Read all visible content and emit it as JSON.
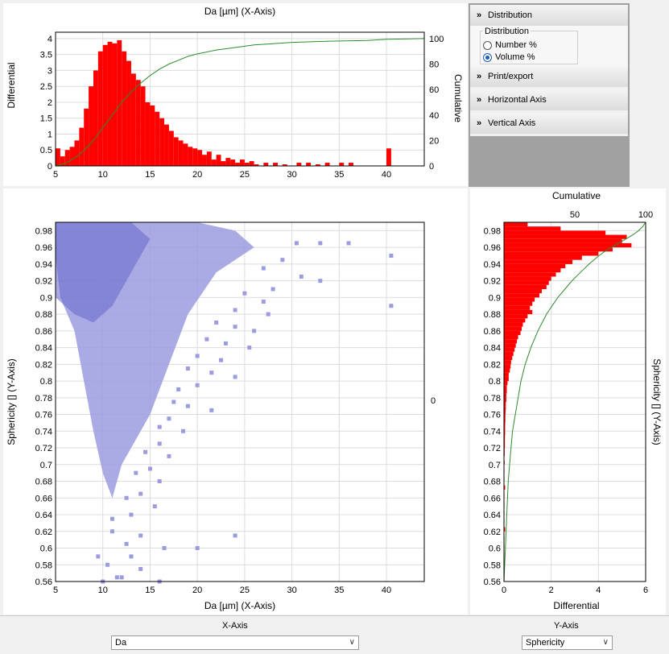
{
  "colors": {
    "histogram": "#ff0000",
    "cumulative": "#2e8b2e",
    "scatter": "#9b9be0",
    "scatter_dense": "#6666cc"
  },
  "panel": {
    "distribution_header": "Distribution",
    "distribution_group": "Distribution",
    "radio_number": "Number %",
    "radio_volume": "Volume %",
    "selected": "Volume %",
    "print_export": "Print/export",
    "horizontal_axis": "Horizontal Axis",
    "vertical_axis": "Vertical Axis",
    "header_icon": "double-chevron-down-icon",
    "item_icon": "double-chevron-right-icon"
  },
  "bottom": {
    "x_axis_label": "X-Axis",
    "x_axis_value": "Da",
    "y_axis_label": "Y-Axis",
    "y_axis_value": "Sphericity"
  },
  "chart_data": [
    {
      "id": "top-histogram",
      "type": "bar",
      "title": "Da [µm] (X-Axis)",
      "ylabel": "Differential",
      "y2label": "Cumulative",
      "xlim": [
        5,
        44
      ],
      "ylim": [
        0,
        4.2
      ],
      "y2lim": [
        0,
        105
      ],
      "xticks": [
        5,
        10,
        15,
        20,
        25,
        30,
        35,
        40
      ],
      "yticks": [
        0,
        0.5,
        1,
        1.5,
        2,
        2.5,
        3,
        3.5,
        4
      ],
      "y2ticks": [
        0,
        20,
        40,
        60,
        80,
        100
      ],
      "grid": true,
      "bin_width": 0.5,
      "bins": [
        [
          5,
          0.55
        ],
        [
          5.5,
          0.3
        ],
        [
          6,
          0.5
        ],
        [
          6.5,
          0.6
        ],
        [
          7,
          0.8
        ],
        [
          7.5,
          1.2
        ],
        [
          8,
          1.8
        ],
        [
          8.5,
          2.5
        ],
        [
          9,
          3.0
        ],
        [
          9.5,
          3.6
        ],
        [
          10,
          3.8
        ],
        [
          10.5,
          3.9
        ],
        [
          11,
          3.85
        ],
        [
          11.5,
          3.95
        ],
        [
          12,
          3.6
        ],
        [
          12.5,
          3.3
        ],
        [
          13,
          2.9
        ],
        [
          13.5,
          2.7
        ],
        [
          14,
          2.5
        ],
        [
          14.5,
          2.0
        ],
        [
          15,
          1.9
        ],
        [
          15.5,
          1.7
        ],
        [
          16,
          1.5
        ],
        [
          16.5,
          1.3
        ],
        [
          17,
          1.1
        ],
        [
          17.5,
          0.9
        ],
        [
          18,
          0.8
        ],
        [
          18.5,
          0.7
        ],
        [
          19,
          0.6
        ],
        [
          19.5,
          0.55
        ],
        [
          20,
          0.5
        ],
        [
          20.5,
          0.35
        ],
        [
          21,
          0.45
        ],
        [
          21.5,
          0.2
        ],
        [
          22,
          0.35
        ],
        [
          22.5,
          0.15
        ],
        [
          23,
          0.25
        ],
        [
          23.5,
          0.2
        ],
        [
          24,
          0.1
        ],
        [
          24.5,
          0.2
        ],
        [
          25,
          0.1
        ],
        [
          25.5,
          0.15
        ],
        [
          26,
          0.05
        ],
        [
          27,
          0.1
        ],
        [
          28,
          0.1
        ],
        [
          29,
          0.05
        ],
        [
          30.5,
          0.1
        ],
        [
          31.5,
          0.1
        ],
        [
          32.5,
          0.05
        ],
        [
          33.5,
          0.1
        ],
        [
          35,
          0.1
        ],
        [
          36,
          0.1
        ],
        [
          40,
          0.55
        ]
      ],
      "cumulative": [
        [
          5,
          0
        ],
        [
          6,
          2
        ],
        [
          7,
          6
        ],
        [
          8,
          12
        ],
        [
          9,
          20
        ],
        [
          10,
          30
        ],
        [
          11,
          40
        ],
        [
          12,
          50
        ],
        [
          13,
          58
        ],
        [
          14,
          65
        ],
        [
          15,
          71
        ],
        [
          16,
          76
        ],
        [
          17,
          80
        ],
        [
          18,
          83
        ],
        [
          19,
          86
        ],
        [
          20,
          88
        ],
        [
          22,
          91
        ],
        [
          24,
          93
        ],
        [
          26,
          95
        ],
        [
          28,
          96
        ],
        [
          30,
          97
        ],
        [
          34,
          98
        ],
        [
          38,
          98.5
        ],
        [
          40,
          99.5
        ],
        [
          44,
          100
        ]
      ]
    },
    {
      "id": "scatter",
      "type": "scatter",
      "xlabel": "Da [µm] (X-Axis)",
      "ylabel": "Sphericity [] (Y-Axis)",
      "xlim": [
        5,
        44
      ],
      "ylim": [
        0.56,
        0.99
      ],
      "xticks": [
        5,
        10,
        15,
        20,
        25,
        30,
        35,
        40
      ],
      "yticks": [
        0.56,
        0.58,
        0.6,
        0.62,
        0.64,
        0.66,
        0.68,
        0.7,
        0.72,
        0.74,
        0.76,
        0.78,
        0.8,
        0.82,
        0.84,
        0.86,
        0.88,
        0.9,
        0.92,
        0.94,
        0.96,
        0.98
      ],
      "y2ticks": [
        0
      ],
      "grid": true,
      "points": [
        [
          30.5,
          0.965
        ],
        [
          33,
          0.965
        ],
        [
          36,
          0.965
        ],
        [
          40.5,
          0.95
        ],
        [
          29,
          0.945
        ],
        [
          27,
          0.935
        ],
        [
          31,
          0.925
        ],
        [
          33,
          0.92
        ],
        [
          28,
          0.91
        ],
        [
          25,
          0.905
        ],
        [
          27,
          0.895
        ],
        [
          40.5,
          0.89
        ],
        [
          24,
          0.885
        ],
        [
          27.5,
          0.88
        ],
        [
          22,
          0.87
        ],
        [
          24,
          0.865
        ],
        [
          26,
          0.86
        ],
        [
          21,
          0.85
        ],
        [
          23,
          0.845
        ],
        [
          25.5,
          0.84
        ],
        [
          20,
          0.83
        ],
        [
          22.5,
          0.825
        ],
        [
          19,
          0.815
        ],
        [
          21.5,
          0.81
        ],
        [
          24,
          0.805
        ],
        [
          20,
          0.795
        ],
        [
          18,
          0.79
        ],
        [
          17.5,
          0.775
        ],
        [
          19,
          0.77
        ],
        [
          21.5,
          0.765
        ],
        [
          17,
          0.755
        ],
        [
          16,
          0.745
        ],
        [
          18.5,
          0.74
        ],
        [
          16,
          0.725
        ],
        [
          14.5,
          0.715
        ],
        [
          17,
          0.71
        ],
        [
          15,
          0.695
        ],
        [
          13.5,
          0.69
        ],
        [
          16,
          0.68
        ],
        [
          14,
          0.665
        ],
        [
          12.5,
          0.66
        ],
        [
          15.5,
          0.65
        ],
        [
          13,
          0.64
        ],
        [
          11,
          0.635
        ],
        [
          24,
          0.615
        ],
        [
          14,
          0.615
        ],
        [
          11,
          0.62
        ],
        [
          12.5,
          0.605
        ],
        [
          16.5,
          0.6
        ],
        [
          20,
          0.6
        ],
        [
          13,
          0.59
        ],
        [
          10.5,
          0.58
        ],
        [
          14,
          0.575
        ],
        [
          9.5,
          0.59
        ],
        [
          11.5,
          0.565
        ],
        [
          10,
          0.56
        ],
        [
          16,
          0.56
        ],
        [
          12,
          0.565
        ]
      ]
    },
    {
      "id": "right-histogram",
      "type": "bar",
      "orientation": "horizontal",
      "xlabel": "Differential",
      "x2label": "Cumulative",
      "ylabel": "Sphericity [] (Y-Axis)",
      "xlim": [
        0,
        6
      ],
      "x2lim": [
        0,
        100
      ],
      "ylim": [
        0.56,
        0.99
      ],
      "xticks": [
        0,
        2,
        4,
        6
      ],
      "x2ticks": [
        50,
        100
      ],
      "yticks": [
        0.56,
        0.58,
        0.6,
        0.62,
        0.64,
        0.66,
        0.68,
        0.7,
        0.72,
        0.74,
        0.76,
        0.78,
        0.8,
        0.82,
        0.84,
        0.86,
        0.88,
        0.9,
        0.92,
        0.94,
        0.96,
        0.98
      ],
      "grid": true,
      "bin_height": 0.005,
      "bins": [
        [
          0.985,
          1.0
        ],
        [
          0.98,
          2.4
        ],
        [
          0.975,
          4.3
        ],
        [
          0.97,
          5.2
        ],
        [
          0.965,
          5.0
        ],
        [
          0.96,
          5.4
        ],
        [
          0.955,
          4.6
        ],
        [
          0.95,
          4.0
        ],
        [
          0.945,
          3.3
        ],
        [
          0.94,
          2.9
        ],
        [
          0.935,
          2.6
        ],
        [
          0.93,
          2.4
        ],
        [
          0.925,
          2.2
        ],
        [
          0.92,
          2.0
        ],
        [
          0.915,
          1.9
        ],
        [
          0.91,
          1.8
        ],
        [
          0.905,
          1.6
        ],
        [
          0.9,
          1.5
        ],
        [
          0.895,
          1.3
        ],
        [
          0.89,
          1.2
        ],
        [
          0.885,
          1.1
        ],
        [
          0.88,
          1.2
        ],
        [
          0.875,
          1.0
        ],
        [
          0.87,
          0.9
        ],
        [
          0.865,
          0.8
        ],
        [
          0.86,
          0.75
        ],
        [
          0.855,
          0.7
        ],
        [
          0.85,
          0.6
        ],
        [
          0.845,
          0.55
        ],
        [
          0.84,
          0.5
        ],
        [
          0.835,
          0.45
        ],
        [
          0.83,
          0.4
        ],
        [
          0.825,
          0.35
        ],
        [
          0.82,
          0.3
        ],
        [
          0.815,
          0.28
        ],
        [
          0.81,
          0.25
        ],
        [
          0.805,
          0.2
        ],
        [
          0.8,
          0.2
        ],
        [
          0.795,
          0.15
        ],
        [
          0.79,
          0.12
        ],
        [
          0.785,
          0.12
        ],
        [
          0.78,
          0.1
        ],
        [
          0.775,
          0.1
        ],
        [
          0.77,
          0.08
        ],
        [
          0.765,
          0.08
        ],
        [
          0.76,
          0.07
        ],
        [
          0.755,
          0.06
        ],
        [
          0.75,
          0.06
        ],
        [
          0.745,
          0.05
        ],
        [
          0.74,
          0.05
        ],
        [
          0.735,
          0.05
        ],
        [
          0.73,
          0.04
        ],
        [
          0.725,
          0.04
        ],
        [
          0.72,
          0.04
        ],
        [
          0.715,
          0.03
        ],
        [
          0.71,
          0.03
        ],
        [
          0.7,
          0.03
        ],
        [
          0.69,
          0.02
        ],
        [
          0.68,
          0.02
        ],
        [
          0.67,
          0.05
        ],
        [
          0.66,
          0.02
        ],
        [
          0.65,
          0.02
        ],
        [
          0.64,
          0.02
        ],
        [
          0.63,
          0.02
        ],
        [
          0.62,
          0.05
        ],
        [
          0.61,
          0.02
        ],
        [
          0.6,
          0.02
        ],
        [
          0.59,
          0.02
        ],
        [
          0.58,
          0.02
        ],
        [
          0.56,
          0.02
        ]
      ],
      "cumulative": [
        [
          0.99,
          100
        ],
        [
          0.985,
          98
        ],
        [
          0.98,
          95
        ],
        [
          0.975,
          91
        ],
        [
          0.97,
          86
        ],
        [
          0.965,
          81
        ],
        [
          0.96,
          76
        ],
        [
          0.955,
          71
        ],
        [
          0.95,
          67
        ],
        [
          0.94,
          60
        ],
        [
          0.93,
          54
        ],
        [
          0.92,
          48
        ],
        [
          0.91,
          43
        ],
        [
          0.9,
          38
        ],
        [
          0.89,
          34
        ],
        [
          0.88,
          30
        ],
        [
          0.86,
          24
        ],
        [
          0.84,
          19
        ],
        [
          0.82,
          15
        ],
        [
          0.8,
          12
        ],
        [
          0.78,
          10
        ],
        [
          0.76,
          8
        ],
        [
          0.74,
          6
        ],
        [
          0.72,
          5
        ],
        [
          0.7,
          4
        ],
        [
          0.68,
          3
        ],
        [
          0.64,
          2
        ],
        [
          0.6,
          1
        ],
        [
          0.56,
          0
        ]
      ]
    }
  ]
}
